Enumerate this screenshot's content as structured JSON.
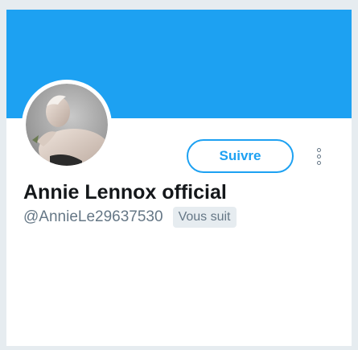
{
  "colors": {
    "banner": "#1da1f2",
    "accent": "#1da1f2",
    "background": "#e6ecf0",
    "text_primary": "#14171a",
    "text_secondary": "#657786"
  },
  "profile": {
    "display_name": "Annie Lennox official",
    "handle": "@AnnieLe29637530",
    "follows_you_label": "Vous suit",
    "avatar_icon": "profile-photo"
  },
  "actions": {
    "follow_label": "Suivre",
    "more_icon": "more-vertical-icon"
  }
}
